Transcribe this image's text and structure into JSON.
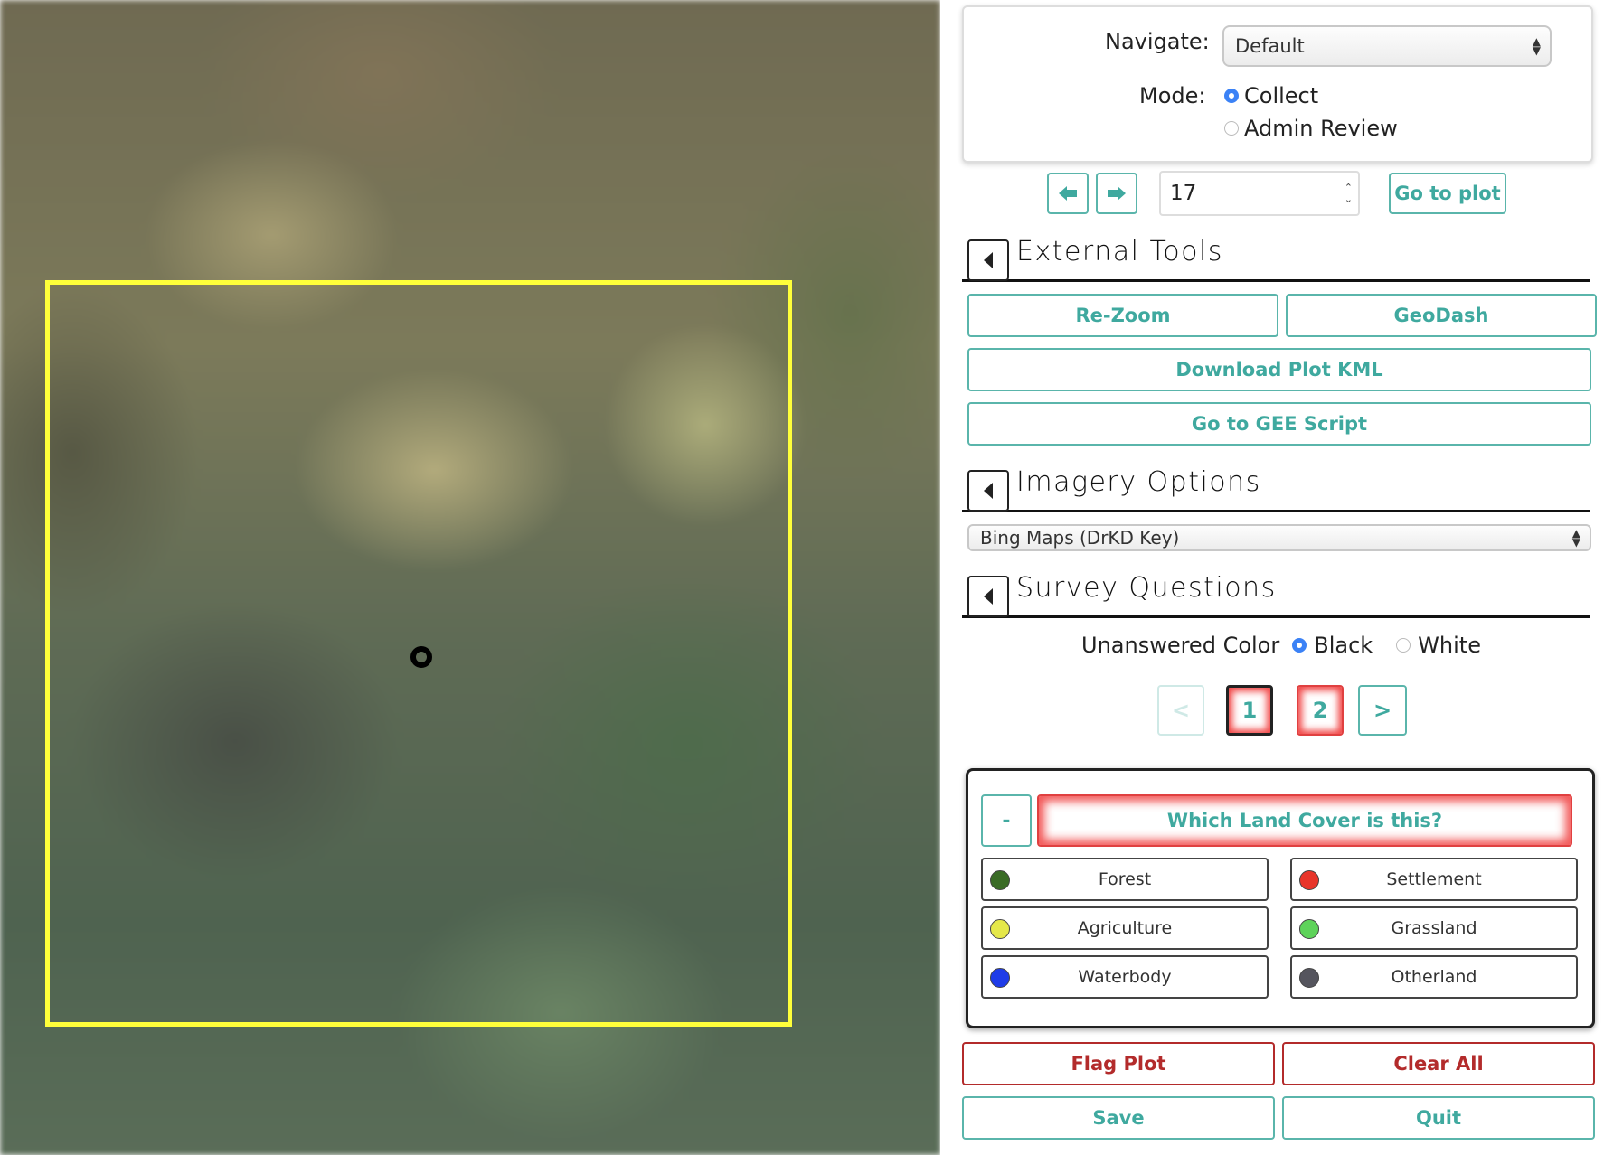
{
  "map": {},
  "navigation": {
    "navigate_label": "Navigate:",
    "navigate_value": "Default",
    "mode_label": "Mode:",
    "mode_options": [
      {
        "label": "Collect",
        "selected": true
      },
      {
        "label": "Admin Review",
        "selected": false
      }
    ],
    "plot_number": "17",
    "go_to_plot_label": "Go to plot"
  },
  "external_tools": {
    "title": "External Tools",
    "re_zoom": "Re-Zoom",
    "geodash": "GeoDash",
    "download_kml": "Download Plot KML",
    "gee_script": "Go to GEE Script"
  },
  "imagery": {
    "title": "Imagery Options",
    "selected": "Bing Maps (DrKD Key)"
  },
  "survey": {
    "title": "Survey Questions",
    "unanswered_color_label": "Unanswered Color",
    "color_options": [
      {
        "label": "Black",
        "selected": true
      },
      {
        "label": "White",
        "selected": false
      }
    ],
    "pager": {
      "prev": "<",
      "pages": [
        "1",
        "2"
      ],
      "next": ">"
    },
    "question": {
      "collapse": "-",
      "text": "Which Land Cover is this?",
      "answers": [
        {
          "label": "Forest",
          "color": "#3a6b26"
        },
        {
          "label": "Settlement",
          "color": "#e8352a"
        },
        {
          "label": "Agriculture",
          "color": "#e5e84a"
        },
        {
          "label": "Grassland",
          "color": "#5ed35a"
        },
        {
          "label": "Waterbody",
          "color": "#1f3ce8"
        },
        {
          "label": "Otherland",
          "color": "#55555e"
        }
      ]
    }
  },
  "actions": {
    "flag_plot": "Flag Plot",
    "clear_all": "Clear All",
    "save": "Save",
    "quit": "Quit"
  },
  "colors": {
    "teal": "#3fa99f",
    "red": "#b32b2b",
    "plot_outline": "#ffff3a"
  }
}
